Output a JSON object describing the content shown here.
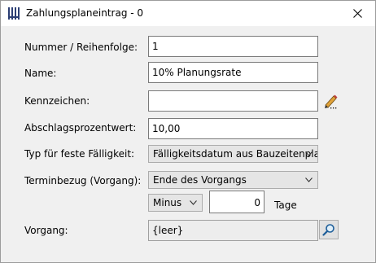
{
  "window": {
    "title": "Zahlungsplaneintrag - 0"
  },
  "form": {
    "nummer": {
      "label": "Nummer / Reihenfolge:",
      "value": "1"
    },
    "name": {
      "label": "Name:",
      "value": "10% Planungsrate"
    },
    "kennzeichen": {
      "label": "Kennzeichen:",
      "value": ""
    },
    "abschlag": {
      "label": "Abschlagsprozentwert:",
      "value": "10,00"
    },
    "typ": {
      "label": "Typ für feste Fälligkeit:",
      "selected": "Fälligkeitsdatum aus Bauzeitenplan"
    },
    "terminbezug": {
      "label": "Terminbezug (Vorgang):",
      "selected": "Ende des Vorgangs"
    },
    "offset": {
      "direction": "Minus",
      "days": "0",
      "unit": "Tage"
    },
    "vorgang": {
      "label": "Vorgang:",
      "value": "{leer}"
    }
  },
  "icons": {
    "app": "app-icon",
    "close": "close-icon",
    "edit": "pencil-icon",
    "search": "magnifier-icon"
  },
  "colors": {
    "dialog_background": "#f0f0f0",
    "app_icon": "#2b3e73",
    "pencil_accent": "#e0a23a"
  }
}
